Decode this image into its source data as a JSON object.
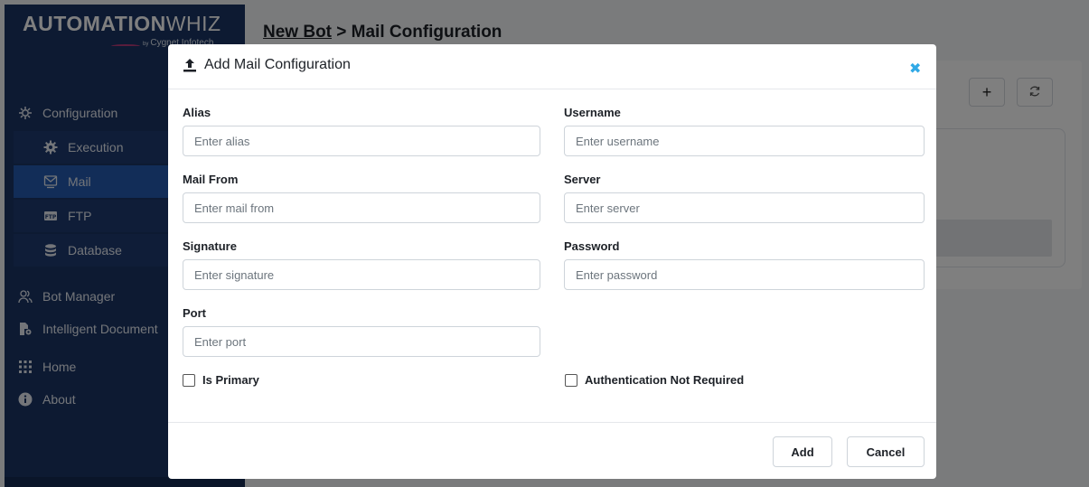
{
  "logo": {
    "bold": "AUTOMATION",
    "light": "WHIZ",
    "by": "by",
    "company": "Cygnet Infotech"
  },
  "breadcrumb": {
    "parent": "New Bot",
    "separator": " > ",
    "current": "Mail Configuration"
  },
  "sidebar": {
    "configuration": "Configuration",
    "sub_items": [
      {
        "label": "Execution",
        "icon": "gear-icon"
      },
      {
        "label": "Mail",
        "icon": "mail-icon",
        "active": true
      },
      {
        "label": "FTP",
        "icon": "ftp-icon"
      },
      {
        "label": "Database",
        "icon": "database-icon"
      }
    ],
    "items": [
      {
        "label": "Bot Manager",
        "icon": "users-icon"
      },
      {
        "label": "Intelligent Document",
        "icon": "document-gear-icon"
      },
      {
        "label": "Home",
        "icon": "grid-icon"
      },
      {
        "label": "About",
        "icon": "info-icon"
      }
    ]
  },
  "background_toolbar": {
    "add": "+",
    "refresh": "↻"
  },
  "modal": {
    "title": "Add Mail Configuration",
    "close": "✖",
    "fields": {
      "alias": {
        "label": "Alias",
        "placeholder": "Enter alias",
        "value": ""
      },
      "username": {
        "label": "Username",
        "placeholder": "Enter username",
        "value": ""
      },
      "mail_from": {
        "label": "Mail From",
        "placeholder": "Enter mail from",
        "value": ""
      },
      "server": {
        "label": "Server",
        "placeholder": "Enter server",
        "value": ""
      },
      "signature": {
        "label": "Signature",
        "placeholder": "Enter signature",
        "value": ""
      },
      "password": {
        "label": "Password",
        "placeholder": "Enter password",
        "value": ""
      },
      "port": {
        "label": "Port",
        "placeholder": "Enter port",
        "value": ""
      }
    },
    "checkboxes": {
      "is_primary": {
        "label": "Is Primary",
        "checked": false
      },
      "auth_not_required": {
        "label": "Authentication Not Required",
        "checked": false
      }
    },
    "buttons": {
      "add": "Add",
      "cancel": "Cancel"
    }
  },
  "colors": {
    "sidebar": "#1b3565",
    "active_item": "#255bb0",
    "close_icon": "#30a9e6"
  }
}
